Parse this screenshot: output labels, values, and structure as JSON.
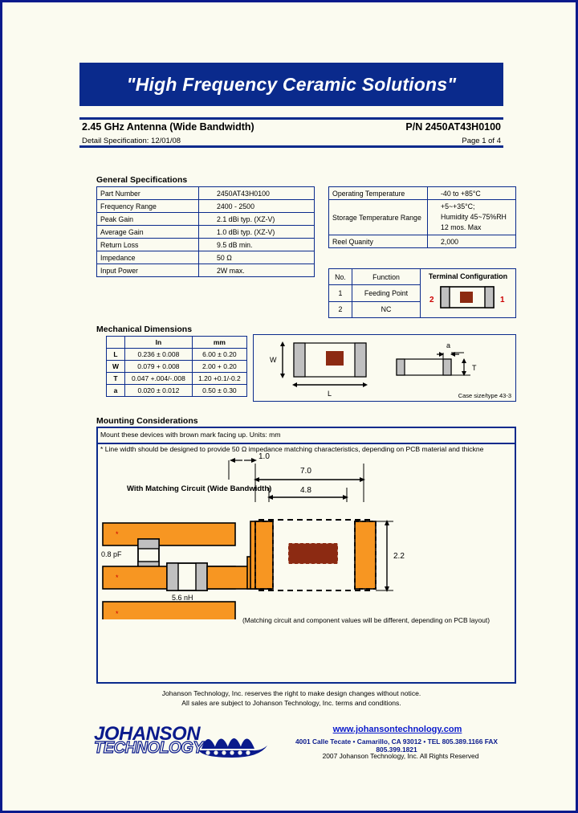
{
  "banner": {
    "slogan": "\"High Frequency Ceramic Solutions\""
  },
  "titlebar": {
    "product_title": "2.45 GHz Antenna (Wide Bandwidth)",
    "part_number": "P/N 2450AT43H0100",
    "spec_label": "Detail Specification:   12/01/08",
    "page_label": "Page 1 of 4"
  },
  "general_specs": {
    "heading": "General Specifications",
    "rows": [
      {
        "key": "Part Number",
        "value": "2450AT43H0100"
      },
      {
        "key": "Frequency Range",
        "value": "2400 - 2500"
      },
      {
        "key": "Peak Gain",
        "value": "2.1  dBi typ. (XZ-V)"
      },
      {
        "key": "Average Gain",
        "value": "1.0  dBi typ. (XZ-V)"
      },
      {
        "key": "Return Loss",
        "value": "9.5 dB min."
      },
      {
        "key": "Impedance",
        "value": "50 Ω"
      },
      {
        "key": "Input Power",
        "value": "2W max."
      }
    ]
  },
  "env_specs": {
    "rows": [
      {
        "key": "Operating Temperature",
        "value": "-40 to +85°C"
      },
      {
        "key": "Storage Temperature Range",
        "value": "+5~+35°C;\nHumidity 45~75%RH\n12 mos. Max"
      },
      {
        "key": "Reel Quanity",
        "value": "2,000"
      }
    ]
  },
  "terminal": {
    "col_no": "No.",
    "col_function": "Function",
    "config_title": "Terminal Configuration",
    "rows": [
      {
        "no": "1",
        "function": "Feeding Point"
      },
      {
        "no": "2",
        "function": "NC"
      }
    ],
    "left_marker": "2",
    "right_marker": "1",
    "marker_color": "#cc0000"
  },
  "mechanical": {
    "heading": "Mechanical Dimensions",
    "col_in": "In",
    "col_mm": "mm",
    "rows": [
      {
        "label": "L",
        "in": "0.236  ±  0.008",
        "mm": "6.00  ±  0.20"
      },
      {
        "label": "W",
        "in": "0.079  +  0.008",
        "mm": "2.00  +  0.20"
      },
      {
        "label": "T",
        "in": "0.047  +.004/-.008",
        "mm": "1.20    +0.1/-0.2"
      },
      {
        "label": "a",
        "in": "0.020  ±  0.012",
        "mm": "0.50  ±  0.30"
      }
    ],
    "drawing": {
      "dim_w": "W",
      "dim_l": "L",
      "dim_t": "T",
      "dim_a": "a",
      "case_note": "Case size/type 43-3"
    }
  },
  "mounting": {
    "heading": "Mounting Considerations",
    "note_line1": "Mount these devices with brown mark facing up. Units: mm",
    "note_line2": "* Line width should be designed to provide 50 Ω impedance matching characteristics, depending on PCB material and thickne",
    "circuit_title": "With Matching Circuit (Wide Bandwidth)",
    "cap_value": "0.8 pF",
    "ind_value": "5.6 nH",
    "dim_1_0": "1.0",
    "dim_7_0": "7.0",
    "dim_4_8": "4.8",
    "dim_2_2": "2.2",
    "disclaimer_note": "(Matching circuit and component values will be different, depending on PCB layout)"
  },
  "footer": {
    "disclaimer1": "Johanson Technology, Inc. reserves the right to make design changes without notice.",
    "disclaimer2": "All sales are subject to Johanson Technology, Inc. terms and conditions.",
    "logo_line1": "JOHANSON",
    "logo_line2": "TECHNOLOGY",
    "website": "www.johansontechnology.com",
    "address": "4001 Calle Tecate • Camarillo, CA 93012 • TEL 805.389.1166 FAX 805.399.1821",
    "copyright": "2007 Johanson Technology, Inc.  All Rights Reserved"
  },
  "colors": {
    "brand_blue": "#0a2a8c",
    "pad_orange": "#f79622",
    "brown_mark": "#8c2a12",
    "terminal_gray": "#c0c0c0"
  }
}
